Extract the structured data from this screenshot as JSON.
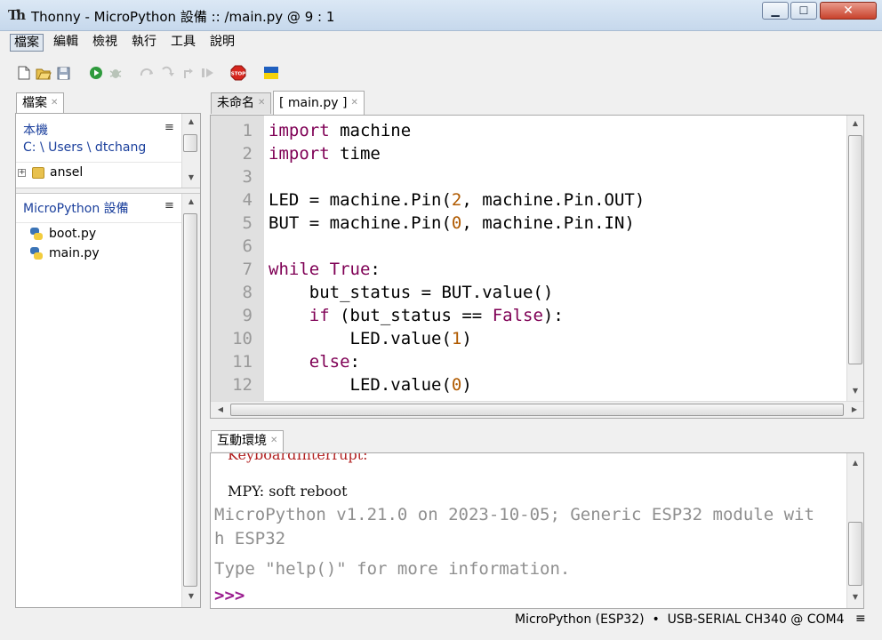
{
  "window": {
    "title": "Thonny  -  MicroPython 設備 :: /main.py  @  9 : 1",
    "min_glyph": "▁",
    "max_glyph": "☐",
    "close_glyph": "✕"
  },
  "menu": [
    "檔案",
    "編輯",
    "檢視",
    "執行",
    "工具",
    "說明"
  ],
  "toolbar": {
    "icons": [
      "new-file-icon",
      "open-file-icon",
      "save-icon",
      "run-icon",
      "debug-icon",
      "step-over-icon",
      "step-into-icon",
      "step-out-icon",
      "resume-icon",
      "stop-icon",
      "ukraine-flag-icon"
    ],
    "stop_label": "STOP"
  },
  "files_panel": {
    "tab": "檔案",
    "local_title": "本機",
    "local_path": "C: \\ Users \\ dtchang",
    "local_items": [
      {
        "name": "ansel",
        "type": "folder",
        "expander": "+"
      }
    ],
    "device_title": "MicroPython 設備",
    "device_items": [
      {
        "name": "boot.py"
      },
      {
        "name": "main.py"
      }
    ],
    "menu_glyph": "≡"
  },
  "editor": {
    "tabs": [
      {
        "label": "未命名",
        "active": false
      },
      {
        "label": "[ main.py ]",
        "active": true
      }
    ],
    "line_numbers": [
      "1",
      "2",
      "3",
      "4",
      "5",
      "6",
      "7",
      "8",
      "9",
      "10",
      "11",
      "12"
    ],
    "lines": [
      [
        {
          "t": "import",
          "c": "kw"
        },
        {
          "t": " machine",
          "c": ""
        }
      ],
      [
        {
          "t": "import",
          "c": "kw"
        },
        {
          "t": " time",
          "c": ""
        }
      ],
      [],
      [
        {
          "t": "LED = machine.Pin(",
          "c": ""
        },
        {
          "t": "2",
          "c": "num"
        },
        {
          "t": ", machine.Pin.OUT)",
          "c": ""
        }
      ],
      [
        {
          "t": "BUT = machine.Pin(",
          "c": ""
        },
        {
          "t": "0",
          "c": "num"
        },
        {
          "t": ", machine.Pin.IN)",
          "c": ""
        }
      ],
      [],
      [
        {
          "t": "while",
          "c": "kw"
        },
        {
          "t": " ",
          "c": ""
        },
        {
          "t": "True",
          "c": "kw"
        },
        {
          "t": ":",
          "c": ""
        }
      ],
      [
        {
          "t": "    but_status = BUT.value()",
          "c": ""
        }
      ],
      [
        {
          "t": "    ",
          "c": ""
        },
        {
          "t": "if",
          "c": "kw"
        },
        {
          "t": " (but_status == ",
          "c": ""
        },
        {
          "t": "False",
          "c": "kw"
        },
        {
          "t": "):",
          "c": ""
        }
      ],
      [
        {
          "t": "        LED.value(",
          "c": ""
        },
        {
          "t": "1",
          "c": "num"
        },
        {
          "t": ")",
          "c": ""
        }
      ],
      [
        {
          "t": "    ",
          "c": ""
        },
        {
          "t": "else",
          "c": "kw"
        },
        {
          "t": ":",
          "c": ""
        }
      ],
      [
        {
          "t": "        LED.value(",
          "c": ""
        },
        {
          "t": "0",
          "c": "num"
        },
        {
          "t": ")",
          "c": ""
        }
      ]
    ]
  },
  "shell": {
    "tab": "互動環境",
    "lines": [
      {
        "text": "KeyboardInterrupt:",
        "color": "#b22222"
      },
      {
        "text": "MPY: soft reboot",
        "color": "#111111"
      },
      {
        "text": "MicroPython v1.21.0 on 2023-10-05; Generic ESP32 module wit",
        "color": "#8f8f8f"
      },
      {
        "text": "h ESP32",
        "color": "#8f8f8f"
      },
      {
        "text": "Type \"help()\" for more information.",
        "color": "#8f8f8f"
      },
      {
        "text": ">>>",
        "color": "#9a1b8f"
      }
    ]
  },
  "statusbar": {
    "text": "MicroPython (ESP32)  •  USB-SERIAL CH340 @ COM4",
    "menu_glyph": "≡"
  },
  "colors": {
    "keyword": "#7f0055",
    "number": "#b05a00",
    "link": "#1a3f9c"
  }
}
